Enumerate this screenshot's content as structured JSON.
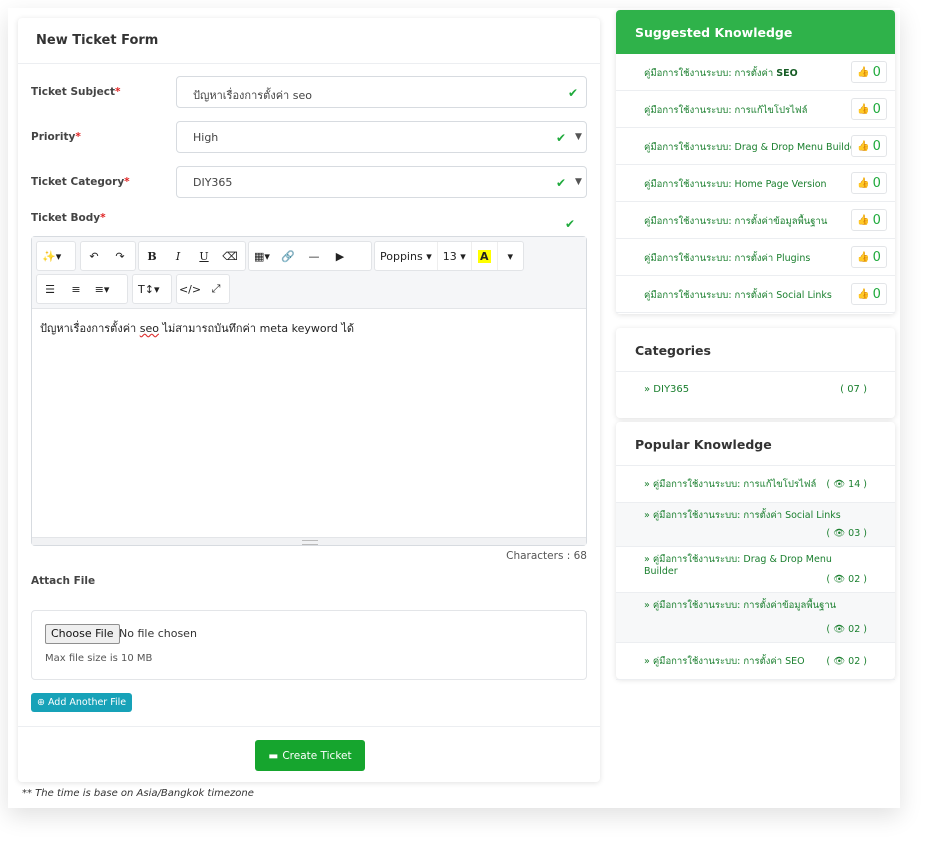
{
  "form": {
    "title": "New Ticket Form",
    "subject_label": "Ticket Subject",
    "subject_value": "ปัญหาเรื่องการตั้งค่า seo",
    "priority_label": "Priority",
    "priority_value": "High",
    "category_label": "Ticket Category",
    "category_value": "DIY365",
    "body_label": "Ticket Body",
    "required_mark": "*",
    "body_text_before": "ปัญหาเรื่องการตั้งค่า ",
    "body_text_seo": "seo",
    "body_text_after": " ไม่สามารถบันทึกค่า meta keyword ได้",
    "characters": "Characters : 68",
    "attach_label": "Attach File",
    "choose_file": "Choose File",
    "no_file": "No file chosen",
    "max_size": "Max file size is 10 MB",
    "add_another": "Add Another File",
    "create_button": "Create Ticket",
    "footnote_prefix": "** The time is base on ",
    "timezone": "Asia/Bangkok",
    "footnote_suffix": " timezone"
  },
  "toolbar": {
    "font_name": "Poppins",
    "font_size": "13",
    "bold": "B",
    "italic": "I",
    "underline": "U",
    "text_height": "T↕",
    "code": "</>",
    "highlight": "A"
  },
  "suggested": {
    "title": "Suggested Knowledge",
    "items": [
      {
        "prefix": "คู่มือการใช้งานระบบ: การตั้งค่า ",
        "bold": "SEO",
        "likes": "0"
      },
      {
        "prefix": "คู่มือการใช้งานระบบ: การแก้ไขโปรไฟล์",
        "bold": "",
        "likes": "0"
      },
      {
        "prefix": "คู่มือการใช้งานระบบ: Drag & Drop Menu Builder",
        "bold": "",
        "likes": "0"
      },
      {
        "prefix": "คู่มือการใช้งานระบบ: Home Page Version",
        "bold": "",
        "likes": "0"
      },
      {
        "prefix": "คู่มือการใช้งานระบบ: การตั้งค่าข้อมูลพื้นฐาน",
        "bold": "",
        "likes": "0"
      },
      {
        "prefix": "คู่มือการใช้งานระบบ: การตั้งค่า Plugins",
        "bold": "",
        "likes": "0"
      },
      {
        "prefix": "คู่มือการใช้งานระบบ: การตั้งค่า Social Links",
        "bold": "",
        "likes": "0"
      }
    ]
  },
  "categories": {
    "title": "Categories",
    "items": [
      {
        "label": "DIY365",
        "count": "( 07 )"
      }
    ]
  },
  "popular": {
    "title": "Popular Knowledge",
    "items": [
      {
        "label": "คู่มือการใช้งานระบบ: การแก้ไขโปรไฟล์",
        "views": "14"
      },
      {
        "label": "คู่มือการใช้งานระบบ: การตั้งค่า Social Links",
        "views": "03"
      },
      {
        "label": "คู่มือการใช้งานระบบ: Drag & Drop Menu Builder",
        "views": "02"
      },
      {
        "label": "คู่มือการใช้งานระบบ: การตั้งค่าข้อมูลพื้นฐาน",
        "views": "02"
      },
      {
        "label": "คู่มือการใช้งานระบบ: การตั้งค่า SEO",
        "views": "02"
      }
    ]
  },
  "colors": {
    "brand_green": "#2fb24a",
    "button_green": "#16a52e",
    "info_blue": "#17a2b8",
    "link_green": "#1a7f2e"
  }
}
